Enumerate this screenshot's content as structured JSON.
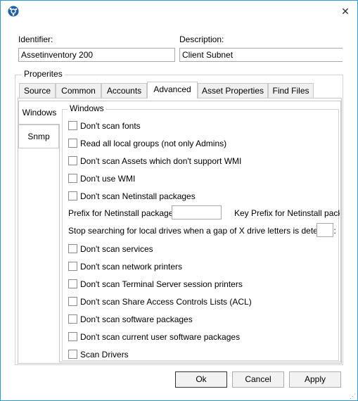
{
  "window": {
    "close_glyph": "✕"
  },
  "fields": {
    "identifier_label": "Identifier:",
    "identifier_value": "Assetinventory 200",
    "description_label": "Description:",
    "description_value": "Client Subnet"
  },
  "properties_group": {
    "title": "Properites"
  },
  "tabs": [
    {
      "label": "Source"
    },
    {
      "label": "Common"
    },
    {
      "label": "Accounts"
    },
    {
      "label": "Advanced"
    },
    {
      "label": "Asset Properties"
    },
    {
      "label": "Find Files"
    }
  ],
  "side_tabs": [
    {
      "label": "Windows"
    },
    {
      "label": "Snmp"
    }
  ],
  "windows_group": {
    "title": "Windows",
    "options": [
      {
        "label": "Don't scan fonts",
        "checked": false
      },
      {
        "label": "Read all local groups (not only Admins)",
        "checked": false
      },
      {
        "label": "Don't scan Assets which don't support WMI",
        "checked": false
      },
      {
        "label": "Don't use WMI",
        "checked": false
      },
      {
        "label": "Don't scan Netinstall packages",
        "checked": false
      },
      {
        "label": "Don't scan services",
        "checked": false
      },
      {
        "label": "Don't scan network printers",
        "checked": false
      },
      {
        "label": "Don't scan Terminal Server session printers",
        "checked": false
      },
      {
        "label": "Don't scan Share Access Controls Lists (ACL)",
        "checked": false
      },
      {
        "label": "Don't scan software packages",
        "checked": false
      },
      {
        "label": "Don't scan current user software packages",
        "checked": false
      },
      {
        "label": "Scan Drivers",
        "checked": false
      }
    ],
    "prefix_label": "Prefix for Netinstall packages:",
    "prefix_value": "",
    "key_prefix_label": "Key Prefix for Netinstall packag",
    "drive_gap_label": "Stop searching for local drives when a gap of X drive letters is detected:",
    "drive_gap_value": ""
  },
  "buttons": {
    "ok": "Ok",
    "cancel": "Cancel",
    "apply": "Apply"
  },
  "colors": {
    "window_border": "#2b9ad6",
    "app_icon": "#1f5ea8"
  }
}
